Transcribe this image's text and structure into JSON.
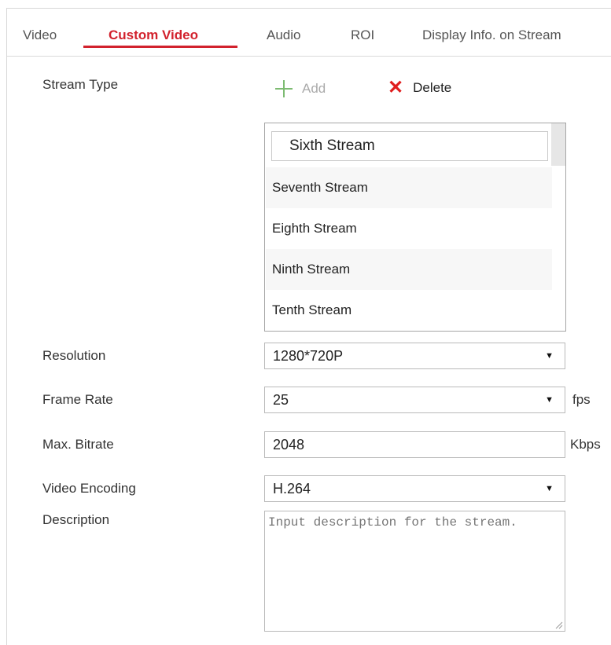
{
  "tabs": [
    {
      "label": "Video"
    },
    {
      "label": "Custom Video"
    },
    {
      "label": "Audio"
    },
    {
      "label": "ROI"
    },
    {
      "label": "Display Info. on Stream"
    }
  ],
  "active_tab": "Custom Video",
  "stream_type": {
    "label": "Stream Type",
    "add_label": "Add",
    "delete_label": "Delete",
    "selected": "Sixth Stream",
    "options": [
      "Seventh Stream",
      "Eighth Stream",
      "Ninth Stream",
      "Tenth Stream"
    ]
  },
  "resolution": {
    "label": "Resolution",
    "value": "1280*720P"
  },
  "frame_rate": {
    "label": "Frame Rate",
    "value": "25",
    "unit": "fps"
  },
  "max_bitrate": {
    "label": "Max. Bitrate",
    "value": "2048",
    "unit": "Kbps"
  },
  "video_encoding": {
    "label": "Video Encoding",
    "value": "H.264"
  },
  "description": {
    "label": "Description",
    "placeholder": "Input description for the stream."
  },
  "icons": {
    "add": "plus-icon",
    "delete": "x-icon",
    "dropdown": "triangle-down-icon"
  },
  "colors": {
    "accent": "#d2222d",
    "add_icon": "#7dbb72",
    "delete_icon": "#e01e1e"
  }
}
